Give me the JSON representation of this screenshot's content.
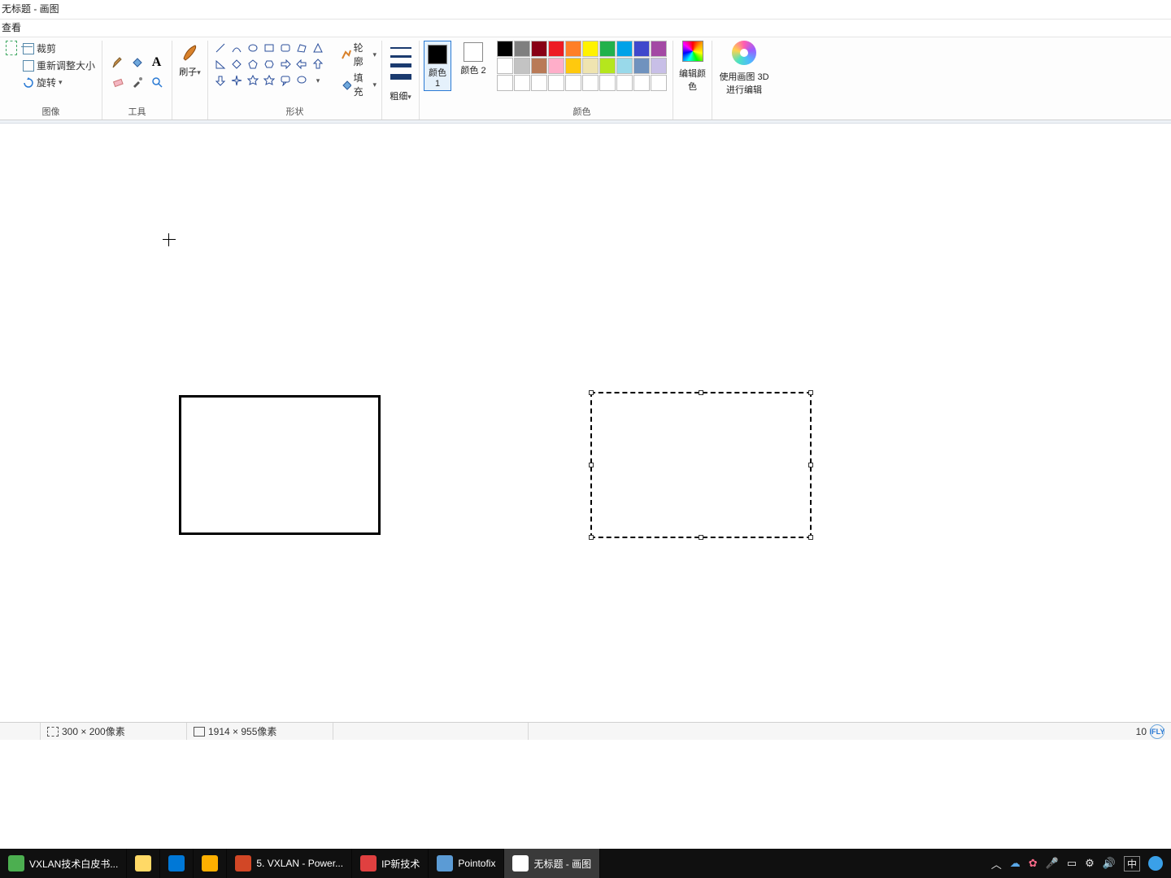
{
  "window": {
    "title": "无标题 - 画图"
  },
  "menu": {
    "view": "查看"
  },
  "ribbon": {
    "image": {
      "label": "图像",
      "crop": "裁剪",
      "resize": "重新调整大小",
      "rotate": "旋转"
    },
    "tools": {
      "label": "工具"
    },
    "brush": {
      "label": "刷子"
    },
    "shapes": {
      "label": "形状",
      "outline": "轮廓",
      "fill": "填充"
    },
    "thickness": {
      "label": "粗细"
    },
    "color1": {
      "label": "颜色 1"
    },
    "color2": {
      "label": "颜色 2"
    },
    "colors": {
      "label": "颜色"
    },
    "edit_colors": {
      "label": "编辑颜色"
    },
    "paint3d": {
      "label": "使用画图 3D 进行编辑"
    }
  },
  "palette": {
    "row1": [
      "#000000",
      "#7f7f7f",
      "#880015",
      "#ed1c24",
      "#ff7f27",
      "#fff200",
      "#22b14c",
      "#00a2e8",
      "#3f48cc",
      "#a349a4"
    ],
    "row2": [
      "#ffffff",
      "#c3c3c3",
      "#b97a57",
      "#ffaec9",
      "#ffc90e",
      "#efe4b0",
      "#b5e61d",
      "#99d9ea",
      "#7092be",
      "#c8bfe7"
    ],
    "row3": [
      "#ffffff",
      "#ffffff",
      "#ffffff",
      "#ffffff",
      "#ffffff",
      "#ffffff",
      "#ffffff",
      "#ffffff",
      "#ffffff",
      "#ffffff"
    ]
  },
  "color1_value": "#000000",
  "color2_value": "#ffffff",
  "status": {
    "selection_size": "300 × 200像素",
    "canvas_size": "1914 × 955像素",
    "zoom": "10"
  },
  "taskbar": {
    "items": [
      {
        "label": "VXLAN技术白皮书...",
        "color": "#4caf50"
      },
      {
        "label": "",
        "color": "#ffd966"
      },
      {
        "label": "",
        "color": "#0078d7"
      },
      {
        "label": "",
        "color": "#ffb000"
      },
      {
        "label": "5. VXLAN - Power...",
        "color": "#d24726"
      },
      {
        "label": "IP新技术",
        "color": "#e04040"
      },
      {
        "label": "Pointofix",
        "color": "#5b9bd5"
      },
      {
        "label": "无标题 - 画图",
        "color": "#ffffff"
      }
    ],
    "ime": "中"
  }
}
